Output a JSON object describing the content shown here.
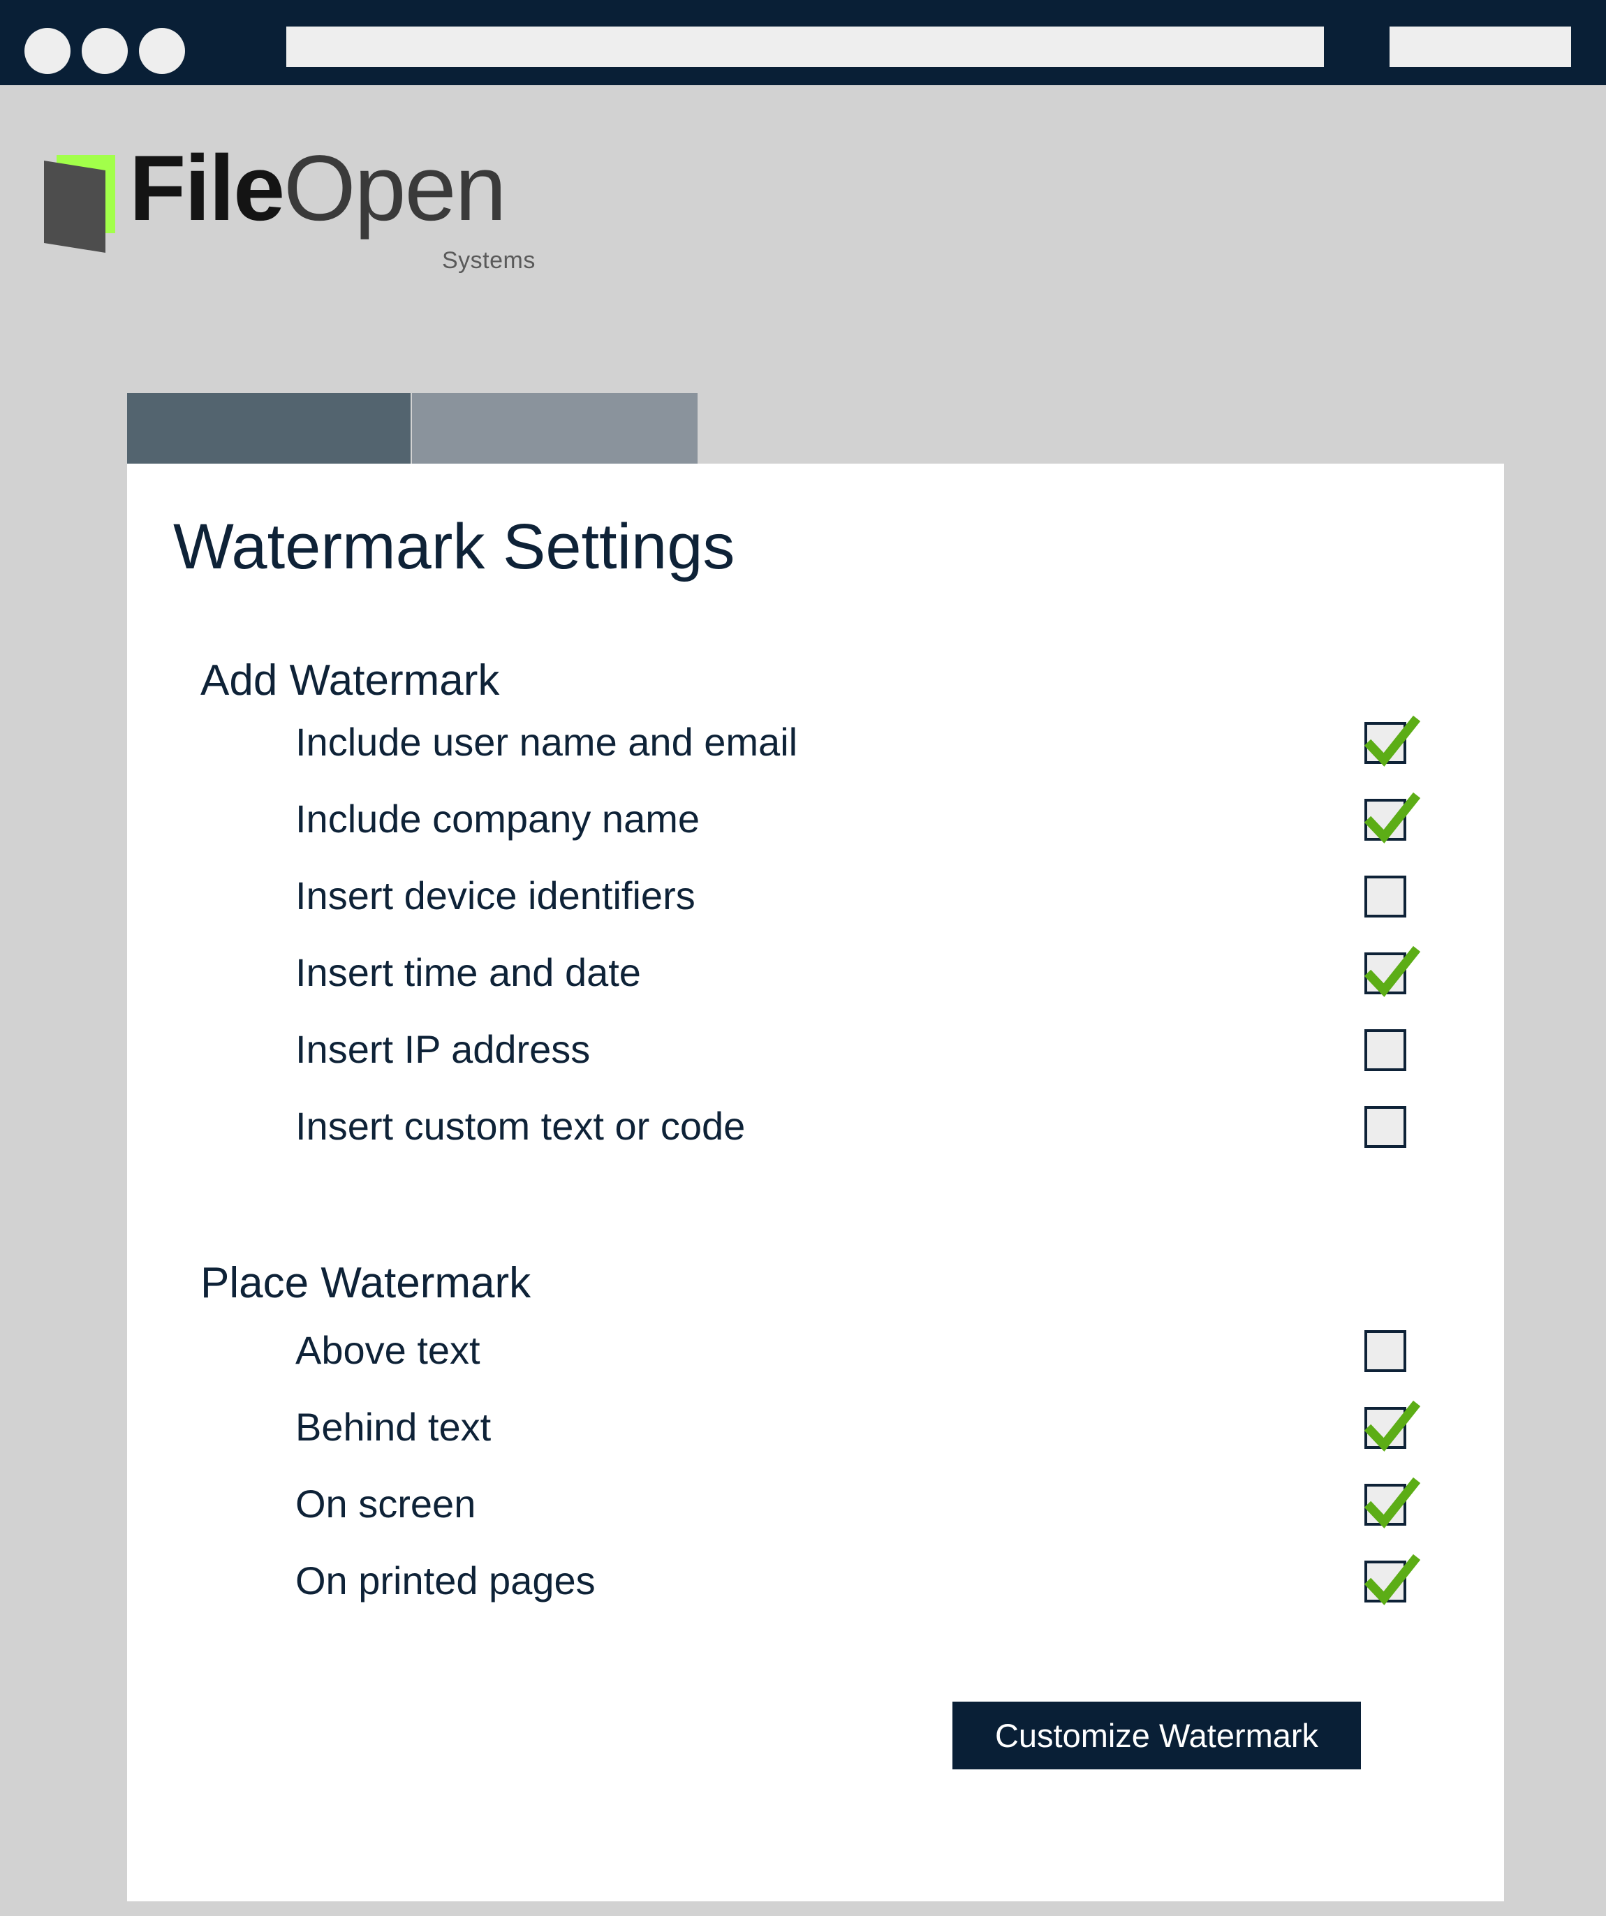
{
  "browser": {
    "traffic_lights": [
      "close",
      "minimize",
      "maximize"
    ],
    "address_bar_value": "",
    "address_bar_placeholder": "",
    "secondary_bar_value": "",
    "chrome_color": "#091f36"
  },
  "brand": {
    "name_bold": "File",
    "name_light": "Open",
    "subtitle": "Systems",
    "mark_green": "#a2ff4a",
    "mark_gray": "#4d4d4d"
  },
  "tabs": [
    {
      "label": "",
      "active": true,
      "color": "#53646f"
    },
    {
      "label": "",
      "active": false,
      "color": "#8a939c"
    }
  ],
  "page": {
    "title": "Watermark Settings",
    "accent_navy": "#0e2237",
    "check_green": "#5cad16"
  },
  "sections": [
    {
      "heading": "Add Watermark",
      "options": [
        {
          "label": "Include user name and email",
          "checked": true
        },
        {
          "label": "Include company name",
          "checked": true
        },
        {
          "label": "Insert device identifiers",
          "checked": false
        },
        {
          "label": "Insert time and date",
          "checked": true
        },
        {
          "label": "Insert IP address",
          "checked": false
        },
        {
          "label": "Insert custom text or code",
          "checked": false
        }
      ]
    },
    {
      "heading": "Place Watermark",
      "options": [
        {
          "label": "Above text",
          "checked": false
        },
        {
          "label": "Behind text",
          "checked": true
        },
        {
          "label": "On screen",
          "checked": true
        },
        {
          "label": "On printed pages",
          "checked": true
        }
      ]
    }
  ],
  "footer": {
    "customize_button_label": "Customize Watermark"
  }
}
